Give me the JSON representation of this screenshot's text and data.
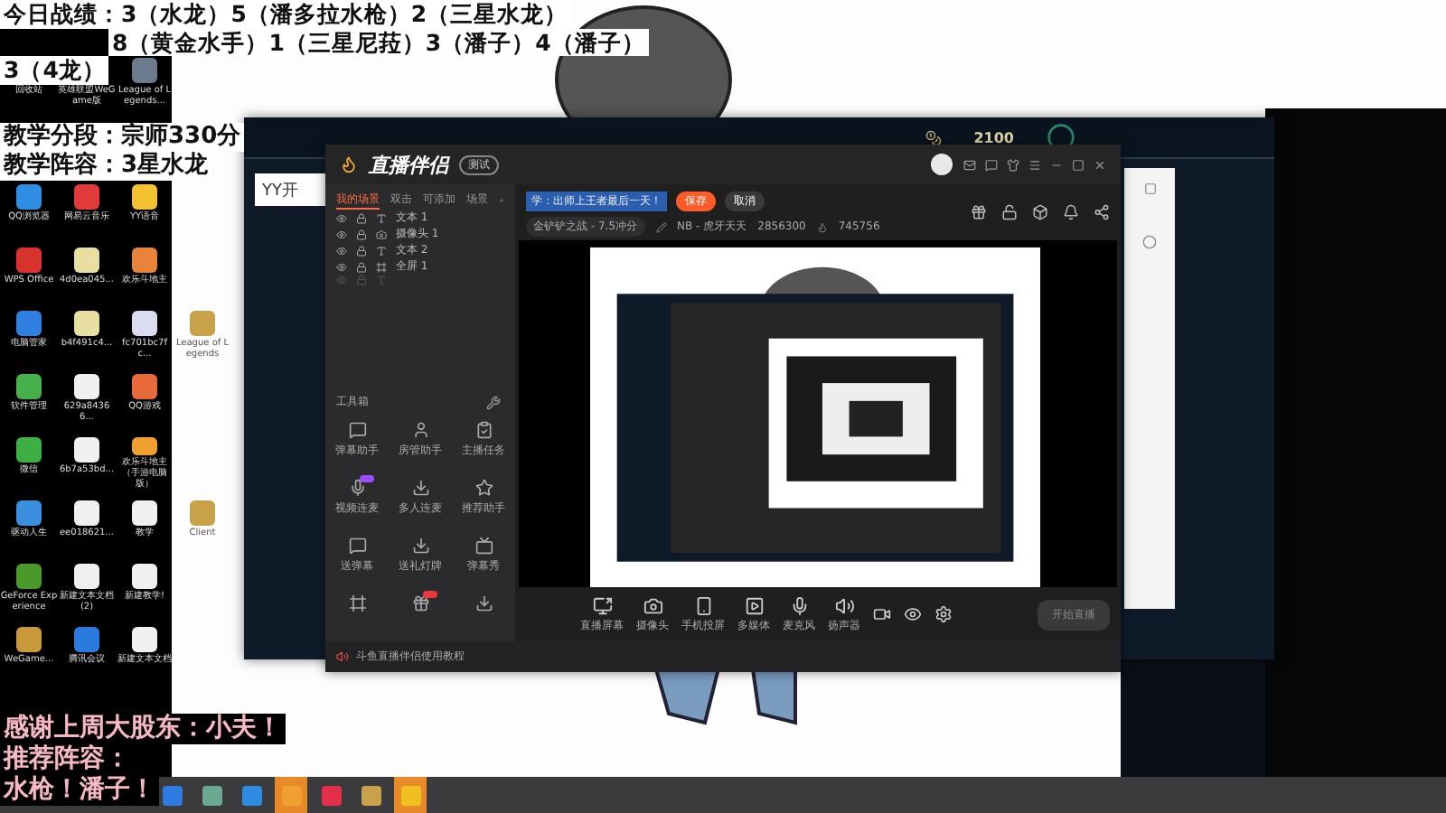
{
  "overlay_top": {
    "lines": [
      "今日战绩：3（水龙）5（潘多拉水枪）2（三星水龙）",
      "8（黄金水手）1（三星尼菈）3（潘子）4（潘子）",
      "3（4龙）"
    ]
  },
  "overlay_stats": [
    "教学分段：宗师330分",
    "教学阵容：3星水龙"
  ],
  "overlay_bottom": [
    "感谢上周大股东：小夫！",
    "推荐阵容：",
    "水枪！潘子！"
  ],
  "desktop_top_row": [
    {
      "label": "回收站"
    },
    {
      "label": "英雄联盟WeGame版"
    },
    {
      "label": "League of Legends..."
    }
  ],
  "desktop_icons": [
    [
      {
        "label": "QQ浏览器",
        "color": "#2f8de4"
      },
      {
        "label": "网易云音乐",
        "color": "#e03a3a"
      },
      {
        "label": "YY语音",
        "color": "#f2c230"
      }
    ],
    [
      {
        "label": "WPS Office",
        "color": "#d8322c"
      },
      {
        "label": "4d0ea045...",
        "color": "#e8e0a0"
      },
      {
        "label": "欢乐斗地主",
        "color": "#e8843a"
      }
    ],
    [
      {
        "label": "电脑管家",
        "color": "#2f7fe0"
      },
      {
        "label": "b4f491c4...",
        "color": "#e8e0a0"
      },
      {
        "label": "fc701bc7fc...",
        "color": "#dcdcf0"
      },
      {
        "label": "League of Legends",
        "color": "#c8a24a"
      }
    ],
    [
      {
        "label": "软件管理",
        "color": "#46b04a"
      },
      {
        "label": "629a84366...",
        "color": "#f0f0f0"
      },
      {
        "label": "QQ游戏",
        "color": "#e86a3a"
      }
    ],
    [
      {
        "label": "微信",
        "color": "#3cb043"
      },
      {
        "label": "6b7a53bd...",
        "color": "#f0f0f0"
      },
      {
        "label": "欢乐斗地主（手游电脑版）",
        "color": "#f0a030"
      }
    ],
    [
      {
        "label": "驱动人生",
        "color": "#3a8ee0"
      },
      {
        "label": "ee018621...",
        "color": "#f0f0f0"
      },
      {
        "label": "教学",
        "color": "#f0f0f0"
      },
      {
        "label": "Client",
        "color": "#c8a24a"
      }
    ],
    [
      {
        "label": "GeForce Experience",
        "color": "#4a9a2a"
      },
      {
        "label": "新建文本文档 (2)",
        "color": "#f0f0f0"
      },
      {
        "label": "新建教学!",
        "color": "#f0f0f0"
      }
    ],
    [
      {
        "label": "WeGame...",
        "color": "#c89a3a"
      },
      {
        "label": "腾讯会议",
        "color": "#2a7ae0"
      },
      {
        "label": "新建文本文档",
        "color": "#f0f0f0"
      }
    ]
  ],
  "game_client": {
    "coins": "2100",
    "tab": "YY开"
  },
  "stream_app": {
    "app_name": "直播伴侣",
    "badge": "测试",
    "scene_tabs": [
      {
        "label": "我的场景",
        "selected": true
      },
      {
        "label": "双击",
        "selected": false
      },
      {
        "label": "可添加",
        "selected": false
      },
      {
        "label": "场景",
        "selected": false
      }
    ],
    "layers": [
      {
        "label": "文本 1",
        "kind": "text",
        "disabled": false
      },
      {
        "label": "摄像头 1",
        "kind": "camera",
        "disabled": false
      },
      {
        "label": "文本 2",
        "kind": "text",
        "disabled": false
      },
      {
        "label": "全屏 1",
        "kind": "screen",
        "disabled": false
      },
      {
        "kind": "text",
        "disabled": true
      }
    ],
    "toolbox_title": "工具箱",
    "tools": [
      {
        "label": "弹幕助手",
        "kind": "chat"
      },
      {
        "label": "房管助手",
        "kind": "user"
      },
      {
        "label": "主播任务",
        "kind": "task"
      },
      {
        "label": "视频连麦",
        "kind": "mic",
        "badge": {
          "color": "#9b4dff"
        }
      },
      {
        "label": "多人连麦",
        "kind": "download"
      },
      {
        "label": "推荐助手",
        "kind": "star"
      },
      {
        "label": "送弹幕",
        "kind": "chat"
      },
      {
        "label": "送礼灯牌",
        "kind": "download"
      },
      {
        "label": "弹幕秀",
        "kind": "tv"
      },
      {
        "kind": "frame"
      },
      {
        "kind": "gift",
        "badge": {
          "color": "#e83a3a"
        }
      },
      {
        "kind": "download"
      }
    ],
    "title_field": {
      "value": "学：出师上王者最后一天！"
    },
    "save_button": "保存",
    "cancel_button": "取消",
    "info": {
      "category": "金铲铲之战 - 7.5冲分",
      "channel": "NB - 虎牙天天",
      "room_id": "2856300",
      "popularity": "745756"
    },
    "controls": [
      {
        "label": "直播屏幕",
        "kind": "screen"
      },
      {
        "label": "摄像头",
        "kind": "camera"
      },
      {
        "label": "手机投屏",
        "kind": "phone"
      },
      {
        "label": "多媒体",
        "kind": "media"
      },
      {
        "label": "麦克风",
        "kind": "mic"
      },
      {
        "label": "扬声器",
        "kind": "speaker"
      }
    ],
    "start_button": "开始直播",
    "status_text": "斗鱼直播伴侣使用教程"
  },
  "taskbar": [
    {
      "color": "#2d7be0",
      "active": false
    },
    {
      "color": "#6aa890",
      "active": false
    },
    {
      "color": "#2d8be0",
      "active": false
    },
    {
      "color": "#f0a030",
      "active": true
    },
    {
      "color": "#e0304a",
      "active": false
    },
    {
      "color": "#c8a24a",
      "active": false
    },
    {
      "color": "#f0c020",
      "active": true
    }
  ]
}
